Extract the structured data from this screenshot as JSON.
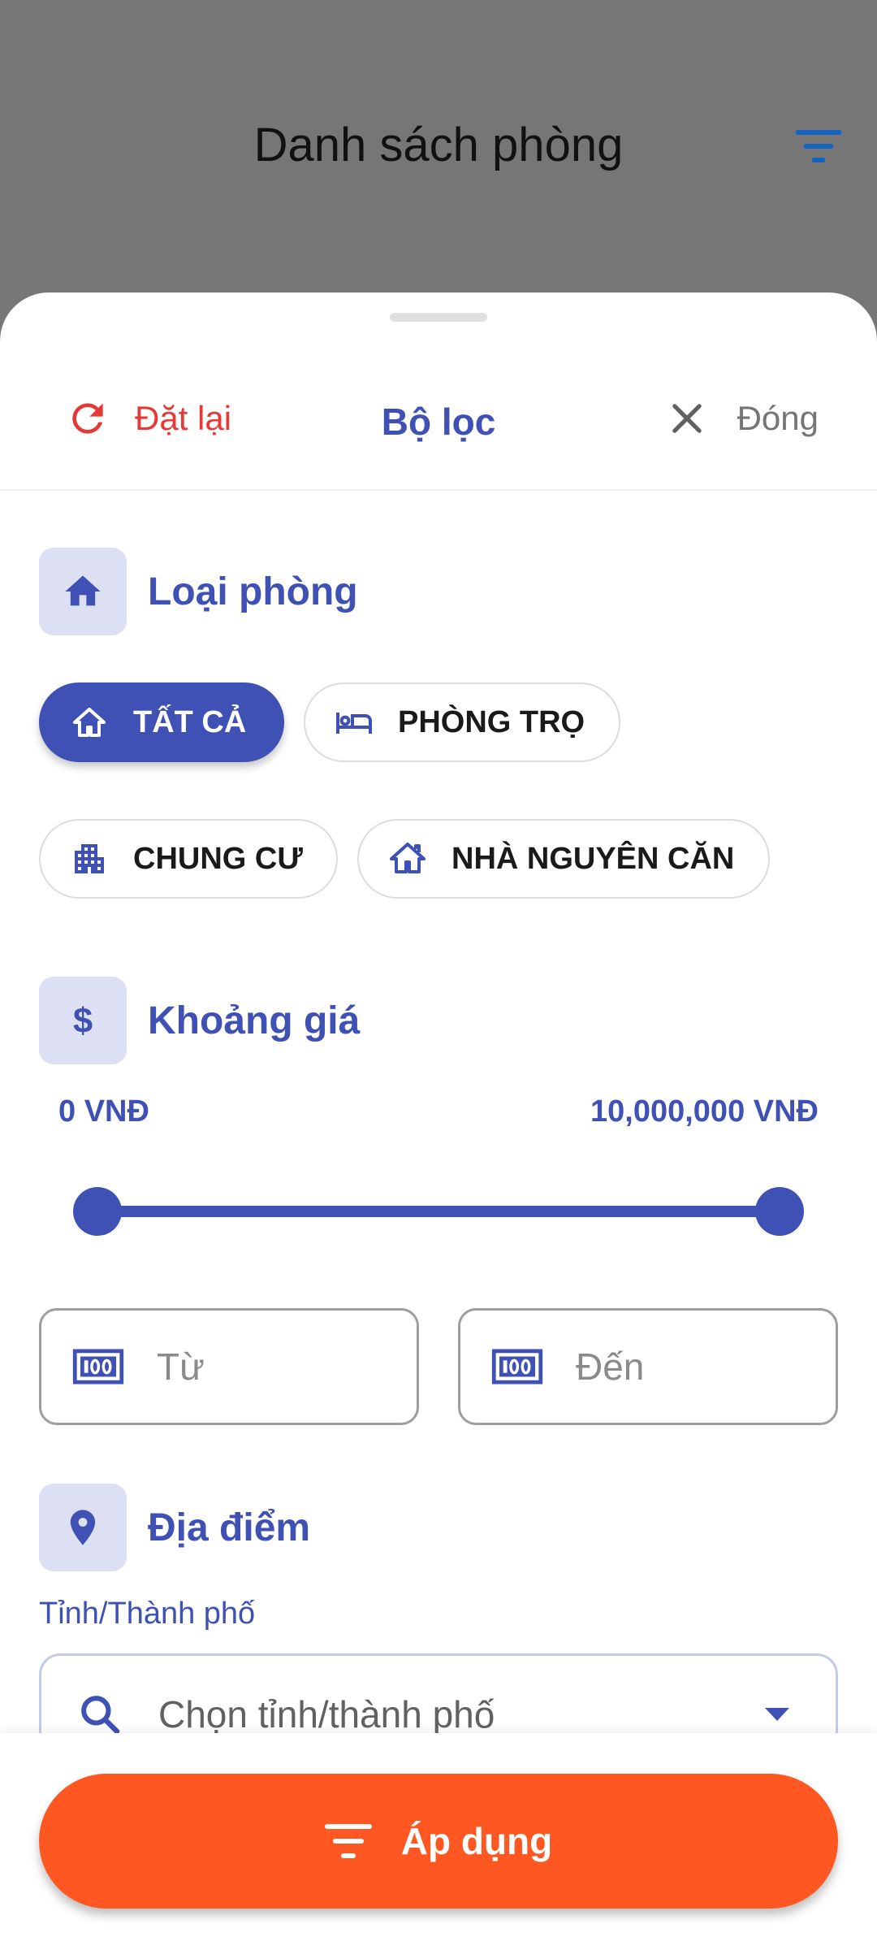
{
  "app_bar": {
    "title": "Danh sách phòng",
    "filter_icon": "filter-icon"
  },
  "sheet": {
    "header": {
      "reset_label": "Đặt lại",
      "title": "Bộ lọc",
      "close_label": "Đóng"
    },
    "room_type": {
      "title": "Loại phòng",
      "icon": "home-icon",
      "chips": [
        {
          "label": "TẤT CẢ",
          "icon": "home-outline-icon",
          "selected": true
        },
        {
          "label": "PHÒNG TRỌ",
          "icon": "bed-icon",
          "selected": false
        },
        {
          "label": "CHUNG CƯ",
          "icon": "apartment-icon",
          "selected": false
        },
        {
          "label": "NHÀ NGUYÊN CĂN",
          "icon": "house-icon",
          "selected": false
        }
      ]
    },
    "price": {
      "title": "Khoảng giá",
      "icon": "dollar-icon",
      "min_label": "0 VNĐ",
      "max_label": "10,000,000 VNĐ",
      "range_min": 0,
      "range_max": 10000000,
      "selected_min": 0,
      "selected_max": 10000000,
      "from_placeholder": "Từ",
      "to_placeholder": "Đến"
    },
    "location": {
      "title": "Địa điểm",
      "icon": "location-pin-icon",
      "city_label": "Tỉnh/Thành phố",
      "city_placeholder": "Chọn tỉnh/thành phố"
    }
  },
  "footer": {
    "apply_label": "Áp dụng"
  },
  "colors": {
    "primary": "#3f51b5",
    "accent": "#ff5722",
    "danger": "#e53935",
    "section_icon_bg": "#dde0f2"
  }
}
